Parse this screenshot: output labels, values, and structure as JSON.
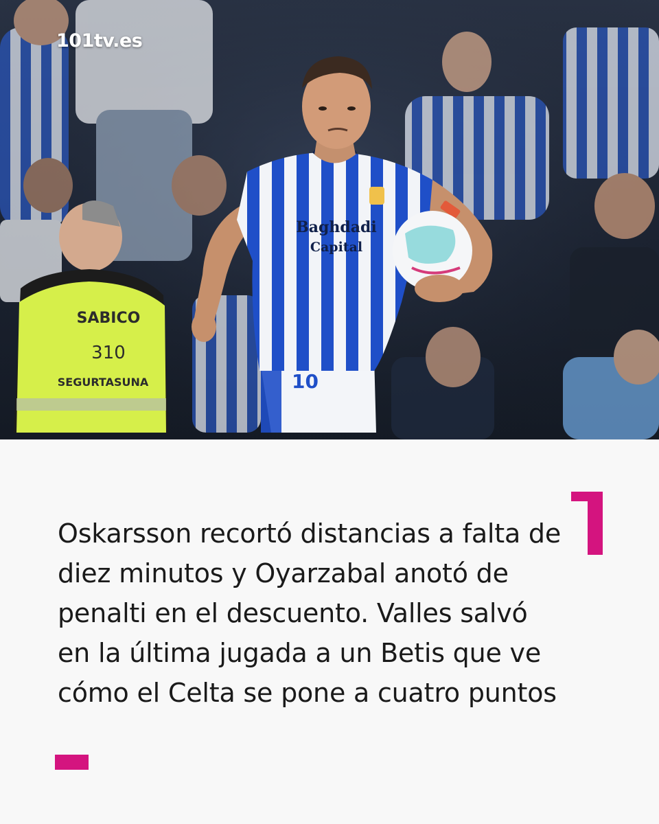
{
  "brand": {
    "logo_text": "101tv.es"
  },
  "photo": {
    "shirt_sponsor_line1": "Baghdadi",
    "shirt_sponsor_line2": "Capital",
    "vest_line1": "SABICO",
    "vest_line2": "310",
    "vest_line3": "SEGURTASUNA"
  },
  "headline": {
    "text": "Oskarsson recortó distancias a falta de diez minutos y Oyarzabal anotó de penalti en el descuento. Valles salvó en la última jugada a un Betis que ve cómo el Celta se pone a cuatro puntos"
  },
  "colors": {
    "accent": "#d4147f",
    "background": "#f8f8f8",
    "text": "#1a1a1a"
  }
}
